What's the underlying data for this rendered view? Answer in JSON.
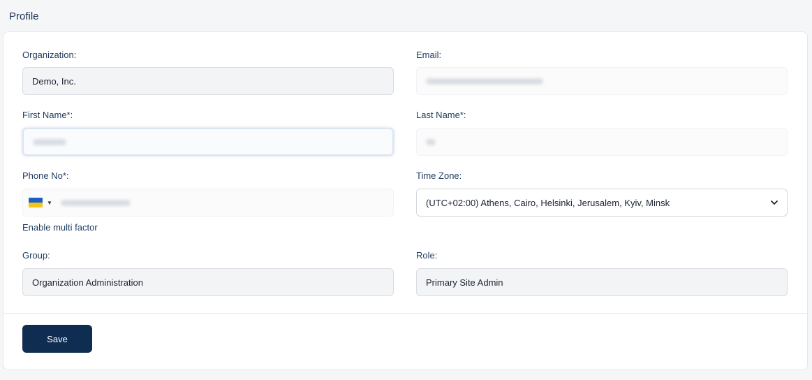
{
  "page": {
    "title": "Profile"
  },
  "form": {
    "organization": {
      "label": "Organization:",
      "value": "Demo, Inc."
    },
    "email": {
      "label": "Email:"
    },
    "first_name": {
      "label": "First Name*:"
    },
    "last_name": {
      "label": "Last Name*:"
    },
    "phone": {
      "label": "Phone No*:",
      "country_flag_icon": "ukraine-flag-icon"
    },
    "time_zone": {
      "label": "Time Zone:",
      "value": "(UTC+02:00) Athens, Cairo, Helsinki, Jerusalem, Kyiv, Minsk"
    },
    "mfa_link": "Enable multi factor",
    "group": {
      "label": "Group:",
      "value": "Organization Administration"
    },
    "role": {
      "label": "Role:",
      "value": "Primary Site Admin"
    }
  },
  "actions": {
    "save_label": "Save"
  },
  "colors": {
    "primary_button": "#0f2d50",
    "label_text": "#1e3a5f",
    "readonly_bg": "#f3f4f6"
  }
}
